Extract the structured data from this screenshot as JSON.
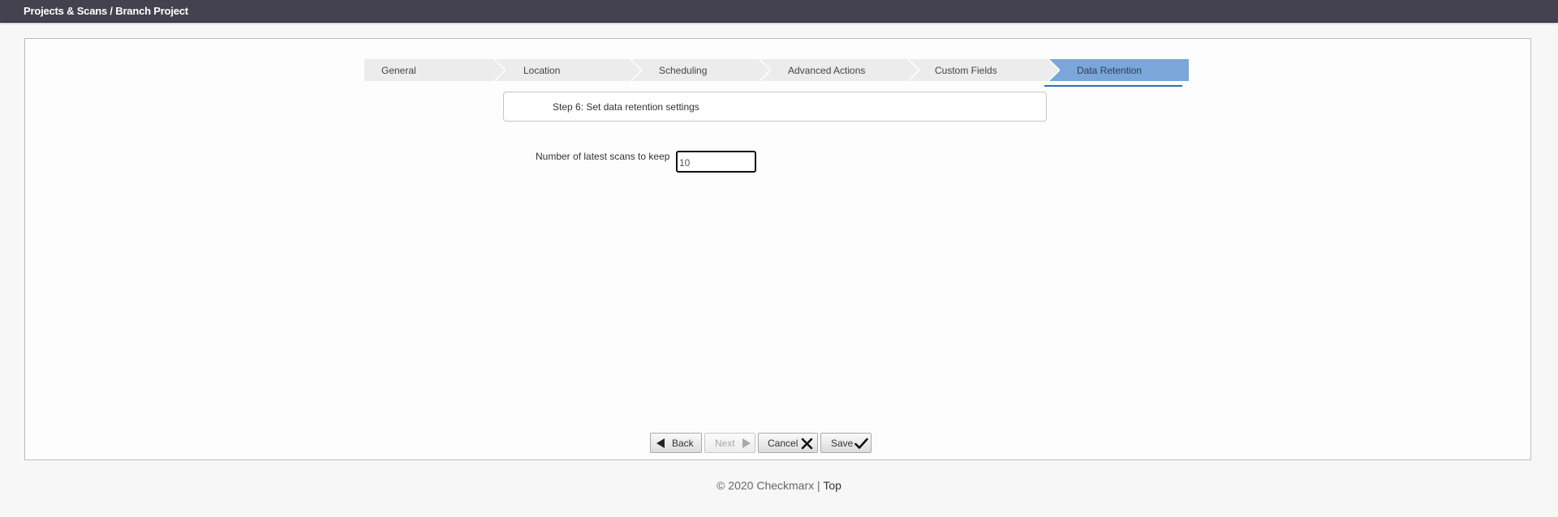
{
  "header": {
    "breadcrumb": "Projects & Scans / Branch Project"
  },
  "wizard": {
    "steps": [
      {
        "label": "General",
        "active": false
      },
      {
        "label": "Location",
        "active": false
      },
      {
        "label": "Scheduling",
        "active": false
      },
      {
        "label": "Advanced Actions",
        "active": false
      },
      {
        "label": "Custom Fields",
        "active": false
      },
      {
        "label": "Data Retention",
        "active": true
      }
    ],
    "step_title": "Step 6: Set data retention settings",
    "active_color": "#7ba6d9",
    "underline_color": "#2f6fbf"
  },
  "form": {
    "scans_label": "Number of latest scans to keep",
    "scans_value": "10"
  },
  "buttons": {
    "back": {
      "label": "Back",
      "icon": "triangle-left-icon"
    },
    "next": {
      "label": "Next",
      "icon": "triangle-right-icon",
      "disabled": true
    },
    "cancel": {
      "label": "Cancel",
      "icon": "close-icon"
    },
    "save": {
      "label": "Save",
      "icon": "checkmark-icon"
    }
  },
  "footer": {
    "copyright": "© 2020 Checkmarx",
    "separator": " | ",
    "top_link": "Top"
  }
}
